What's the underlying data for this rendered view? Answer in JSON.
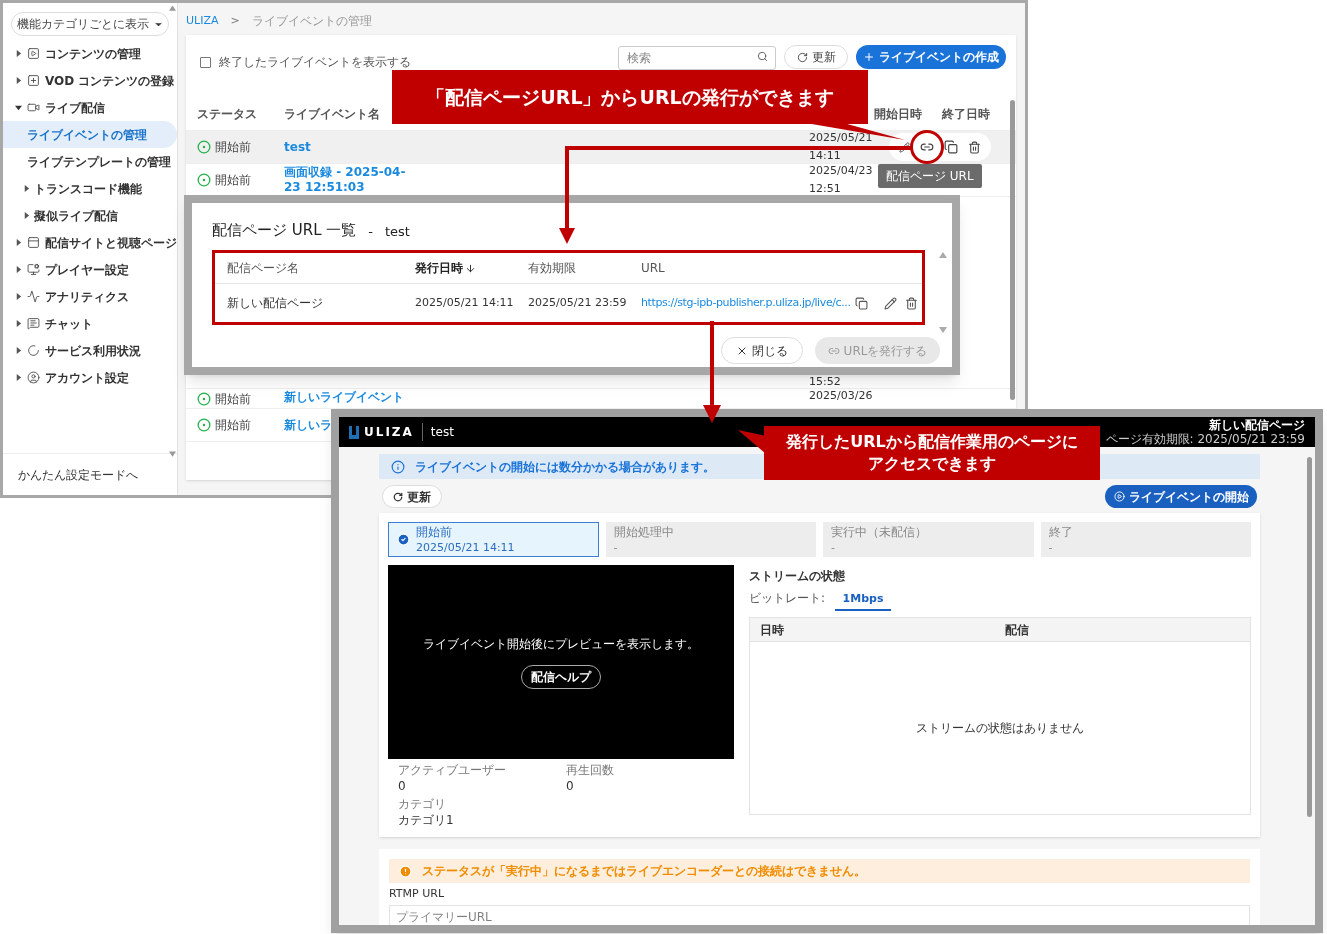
{
  "admin": {
    "category_filter": "機能カテゴリごとに表示",
    "sidebar": [
      {
        "label": "コンテンツの管理",
        "expanded": false,
        "selected": false
      },
      {
        "label": "VOD コンテンツの登録",
        "expanded": false,
        "selected": false
      },
      {
        "label": "ライブ配信",
        "expanded": true,
        "selected": false,
        "children": [
          {
            "label": "ライブイベントの管理",
            "selected": true
          },
          {
            "label": "ライブテンプレートの管理",
            "selected": false
          },
          {
            "label": "トランスコード機能",
            "selected": false,
            "expanded": false
          },
          {
            "label": "擬似ライブ配信",
            "selected": false,
            "expanded": false
          }
        ]
      },
      {
        "label": "配信サイトと視聴ページ",
        "expanded": false,
        "selected": false
      },
      {
        "label": "プレイヤー設定",
        "expanded": false,
        "selected": false
      },
      {
        "label": "アナリティクス",
        "expanded": false,
        "selected": false
      },
      {
        "label": "チャット",
        "expanded": false,
        "selected": false
      },
      {
        "label": "サービス利用状況",
        "expanded": false,
        "selected": false
      },
      {
        "label": "アカウント設定",
        "expanded": false,
        "selected": false
      }
    ],
    "easy_mode_link": "かんたん設定モードへ",
    "breadcrumb": [
      "ULIZA",
      ">",
      "ライブイベントの管理"
    ],
    "show_ended": {
      "label": "終了したライブイベントを表示する",
      "checked": false
    },
    "search": {
      "placeholder": "検索"
    },
    "refresh_button": "更新",
    "create_button": "ライブイベントの作成",
    "columns": [
      "ステータス",
      "ライブイベント名",
      "開始日時",
      "終了日時"
    ],
    "rows": [
      {
        "status": "開始前",
        "name": "test",
        "column_3": [
          "2025/05/21",
          "14:11"
        ],
        "highlighted": true
      },
      {
        "status": "開始前",
        "name": "画面収録 - 2025-04-23 12:51:03",
        "column_3": [
          "2025/04/23",
          "12:51"
        ],
        "highlighted": false
      },
      {
        "column_3": [
          "15:52"
        ],
        "highlighted": false
      },
      {
        "status": "開始前",
        "name": "新しいライブイベント",
        "column_3": [
          "2025/03/26"
        ],
        "highlighted": false
      },
      {
        "status": "開始前",
        "name": "新しいラ",
        "highlighted": false
      }
    ],
    "tooltip": "配信ページ URL"
  },
  "dialog": {
    "title": "配信ページ URL 一覧",
    "separator": "-",
    "event": "test",
    "columns": [
      {
        "label": "配信ページ名",
        "sorted": false
      },
      {
        "label": "発行日時",
        "sorted": true
      },
      {
        "label": "有効期限",
        "sorted": false
      },
      {
        "label": "URL",
        "sorted": false
      }
    ],
    "rows": [
      {
        "name": "新しい配信ページ",
        "issued": "2025/05/21 14:11",
        "expires": "2025/05/21 23:59",
        "url": "https://stg-ipb-publisher.p.uliza.jp/live/c..."
      }
    ],
    "close_button": "閉じる",
    "issue_button": {
      "label": "URLを発行する",
      "disabled": true
    }
  },
  "page": {
    "logo": "ULIZA",
    "event": "test",
    "page_name": "新しい配信ページ",
    "expiry": "ページ有効期限: 2025/05/21 23:59",
    "info": "ライブイベントの開始には数分かかる場合があります。",
    "refresh_button": "更新",
    "start_button": "ライブイベントの開始",
    "steps": [
      {
        "label": "開始前",
        "time": "2025/05/21 14:11",
        "selected": true
      },
      {
        "label": "開始処理中",
        "time": "-",
        "selected": false
      },
      {
        "label": "実行中（未配信）",
        "time": "-",
        "selected": false
      },
      {
        "label": "終了",
        "time": "-",
        "selected": false
      }
    ],
    "preview_message": "ライブイベント開始後にプレビューを表示します。",
    "help_button": "配信ヘルプ",
    "stats": [
      {
        "label": "アクティブユーザー",
        "value": "0"
      },
      {
        "label": "再生回数",
        "value": "0"
      },
      {
        "label": "カテゴリ",
        "value": "カテゴリ1"
      }
    ],
    "stream": {
      "title": "ストリームの状態",
      "bitrate_label": "ビットレート:",
      "tabs": [
        {
          "label": "1Mbps",
          "selected": true
        }
      ],
      "columns": [
        "日時",
        "配信"
      ],
      "empty": "ストリームの状態はありません"
    },
    "warning": "ステータスが「実行中」になるまではライブエンコーダーとの接続はできません。",
    "rtmp_label": "RTMP URL",
    "rtmp_field": {
      "placeholder": "プライマリーURL"
    }
  },
  "callouts": [
    {
      "lines": [
        "「配信ページURL」からURLの発行ができます"
      ]
    },
    {
      "lines": [
        "発行したURLから配信作業用のページに",
        "アクセスできます"
      ]
    }
  ]
}
